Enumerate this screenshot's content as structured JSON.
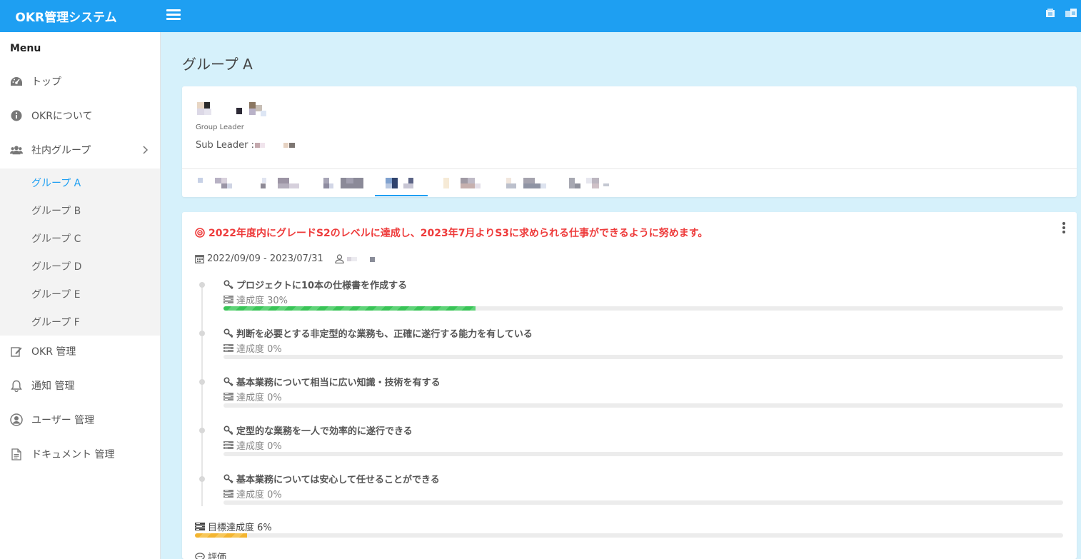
{
  "app": {
    "title": "OKR管理システム"
  },
  "sidebar": {
    "menu_title": "Menu",
    "items": [
      {
        "label": "トップ",
        "icon": "dashboard-icon"
      },
      {
        "label": "OKRについて",
        "icon": "info-icon"
      },
      {
        "label": "社内グループ",
        "icon": "group-icon"
      },
      {
        "label": "OKR 管理",
        "icon": "edit-icon"
      },
      {
        "label": "通知 管理",
        "icon": "bell-icon"
      },
      {
        "label": "ユーザー 管理",
        "icon": "user-circle-icon"
      },
      {
        "label": "ドキュメント 管理",
        "icon": "document-icon"
      }
    ],
    "groups": [
      {
        "label": "グループ A",
        "active": true
      },
      {
        "label": "グループ B",
        "active": false
      },
      {
        "label": "グループ C",
        "active": false
      },
      {
        "label": "グループ D",
        "active": false
      },
      {
        "label": "グループ E",
        "active": false
      },
      {
        "label": "グループ F",
        "active": false
      }
    ]
  },
  "page": {
    "title": "グループ A",
    "group_leader_label": "Group Leader",
    "sub_leader_label": "Sub Leader :"
  },
  "okr": {
    "objective": "2022年度内にグレードS2のレベルに達成し、2023年7月よりS3に求められる仕事ができるように努めます。",
    "period": "2022/09/09 - 2023/07/31",
    "key_results": [
      {
        "title": "プロジェクトに10本の仕様書を作成する",
        "progress_label": "達成度 30%",
        "progress": 0.3
      },
      {
        "title": "判断を必要とする非定型的な業務も、正確に遂行する能力を有している",
        "progress_label": "達成度 0%",
        "progress": 0
      },
      {
        "title": "基本業務について相当に広い知識・技術を有する",
        "progress_label": "達成度 0%",
        "progress": 0
      },
      {
        "title": "定型的な業務を一人で効率的に遂行できる",
        "progress_label": "達成度 0%",
        "progress": 0
      },
      {
        "title": "基本業務については安心して任せることができる",
        "progress_label": "達成度 0%",
        "progress": 0
      }
    ],
    "goal_label": "目標達成度 6%",
    "goal_progress": 0.06,
    "evaluation_label": "評価"
  },
  "colors": {
    "primary": "#1e9ff2",
    "background": "#d6f1fb",
    "objective": "#ee3b3b",
    "kr_progress": "#39c457",
    "goal_progress": "#f3b531"
  }
}
